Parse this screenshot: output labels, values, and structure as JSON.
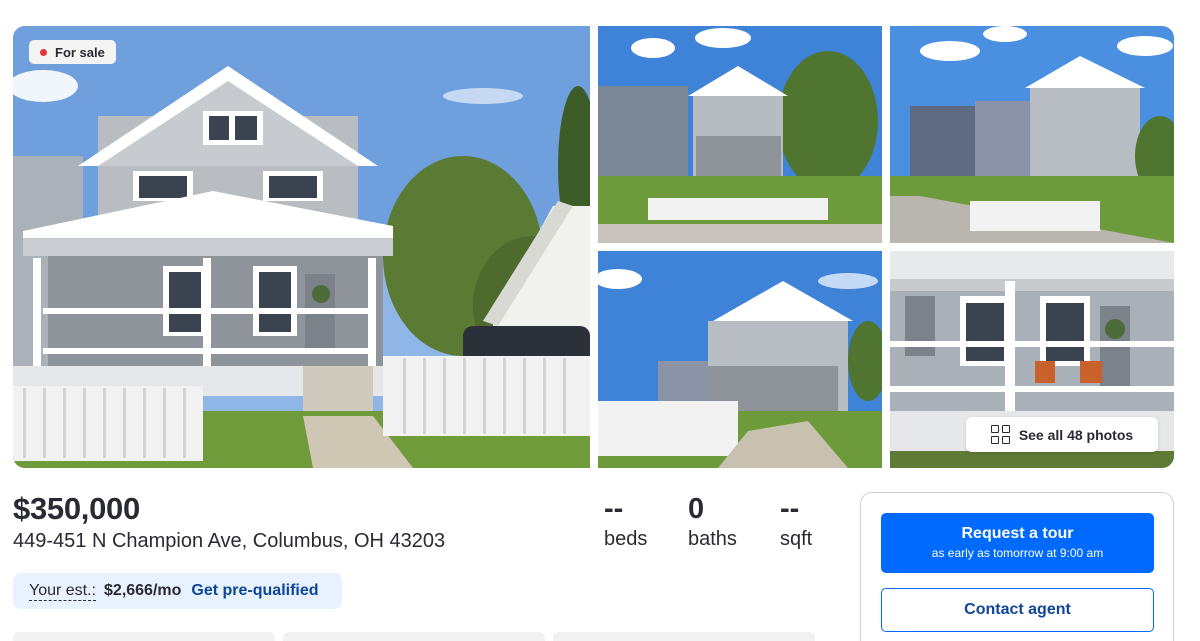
{
  "listing": {
    "status_badge": "For sale",
    "price": "$350,000",
    "address": "449-451 N Champion Ave, Columbus, OH 43203",
    "facts": {
      "beds_value": "--",
      "beds_label": "beds",
      "baths_value": "0",
      "baths_label": "baths",
      "sqft_value": "--",
      "sqft_label": "sqft"
    }
  },
  "gallery": {
    "see_all_label": "See all 48 photos",
    "photo_count": 48
  },
  "payment": {
    "estimate_label": "Your est.:",
    "estimate_amount": "$2,666/mo",
    "prequal_link": "Get pre-qualified"
  },
  "contact": {
    "tour_title": "Request a tour",
    "tour_subtitle": "as early as tomorrow at 9:00 am",
    "agent_label": "Contact agent"
  },
  "colors": {
    "primary": "#006aff",
    "link": "#0d4599",
    "sale_dot": "#e2373d",
    "est_bg": "#e8f2ff"
  }
}
